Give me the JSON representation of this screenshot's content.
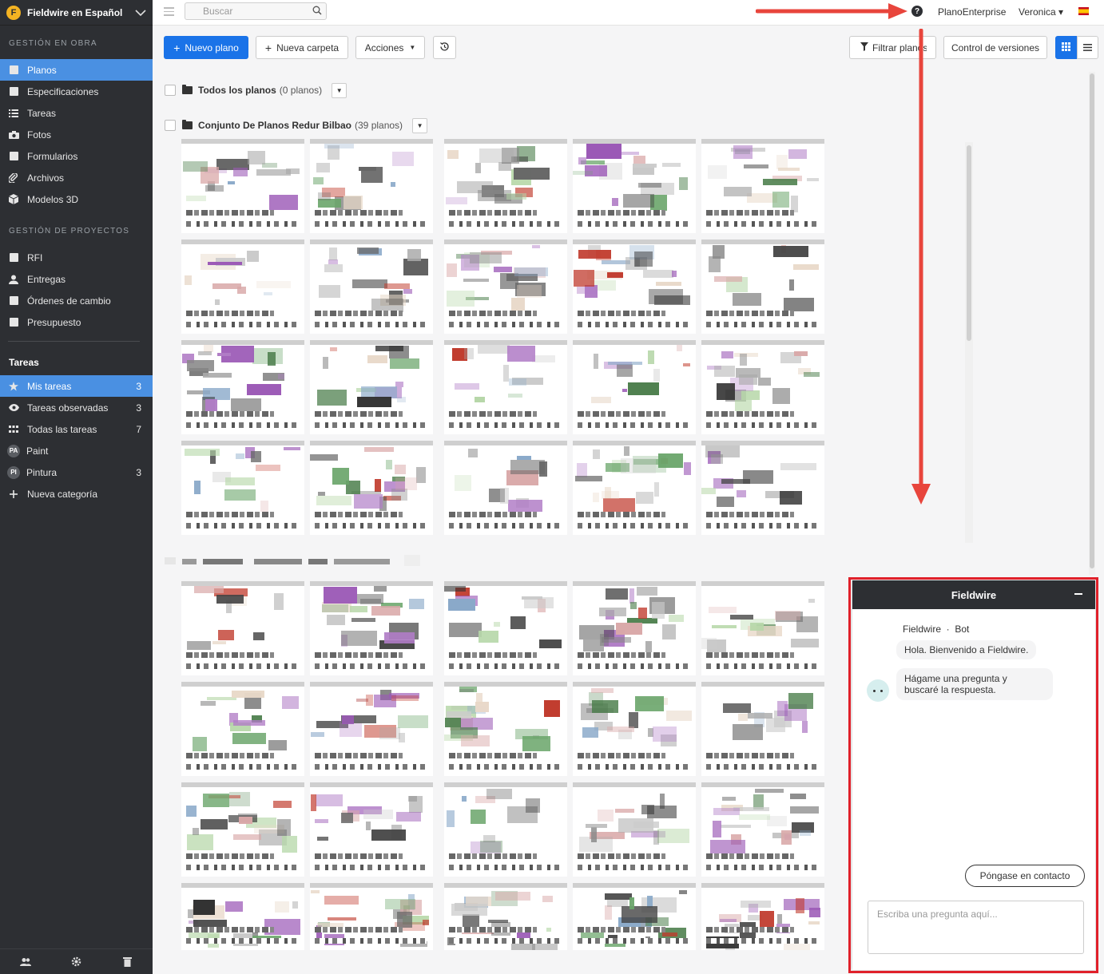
{
  "project": {
    "name": "Fieldwire en Español",
    "logo_char": "F"
  },
  "sidebar": {
    "section_obra": "GESTIÓN EN OBRA",
    "obra_items": [
      {
        "label": "Planos",
        "icon": "plans-icon"
      },
      {
        "label": "Especificaciones",
        "icon": "specs-icon"
      },
      {
        "label": "Tareas",
        "icon": "tasks-list-icon"
      },
      {
        "label": "Fotos",
        "icon": "camera-icon"
      },
      {
        "label": "Formularios",
        "icon": "forms-icon"
      },
      {
        "label": "Archivos",
        "icon": "paperclip-icon"
      },
      {
        "label": "Modelos 3D",
        "icon": "cube-icon"
      }
    ],
    "section_proyectos": "GESTIÓN DE PROYECTOS",
    "proyecto_items": [
      {
        "label": "RFI",
        "icon": "rfi-icon"
      },
      {
        "label": "Entregas",
        "icon": "submittals-icon"
      },
      {
        "label": "Órdenes de cambio",
        "icon": "change-orders-icon"
      },
      {
        "label": "Presupuesto",
        "icon": "calculator-icon"
      }
    ],
    "section_tareas": "Tareas",
    "tareas_items": [
      {
        "label": "Mis tareas",
        "count": "3",
        "icon": "star-icon"
      },
      {
        "label": "Tareas observadas",
        "count": "3",
        "icon": "eye-icon"
      },
      {
        "label": "Todas las tareas",
        "count": "7",
        "icon": "grid-dots-icon"
      },
      {
        "label": "Paint",
        "count": "",
        "badge": "PA"
      },
      {
        "label": "Pintura",
        "count": "3",
        "badge": "PI"
      },
      {
        "label": "Nueva categoría",
        "count": "",
        "icon": "plus-icon"
      }
    ]
  },
  "topbar": {
    "search_placeholder": "Buscar",
    "help_char": "?",
    "plan": "PlanoEnterprise",
    "user": "Veronica ▾"
  },
  "toolbar": {
    "new_plan": "Nuevo plano",
    "new_folder": "Nueva carpeta",
    "actions": "Acciones",
    "filter": "Filtrar planos",
    "version_control": "Control de versiones"
  },
  "folders": [
    {
      "name": "Todos los planos",
      "count": "(0 planos)"
    },
    {
      "name": "Conjunto De Planos Redur Bilbao",
      "count": "(39 planos)"
    }
  ],
  "chat": {
    "title": "Fieldwire",
    "sender": "Fieldwire  ·  Bot",
    "greeting": "Hola. Bienvenido a Fieldwire.",
    "prompt_line1": "Hágame una pregunta y",
    "prompt_line2": "buscaré la respuesta.",
    "contact_button": "Póngase en contacto",
    "input_placeholder": "Escriba una pregunta aquí..."
  },
  "colors": {
    "accent": "#1a73e8",
    "sidebar_bg": "#2d2f33",
    "active_nav": "#4a90e2",
    "annotation": "#e0202a"
  }
}
